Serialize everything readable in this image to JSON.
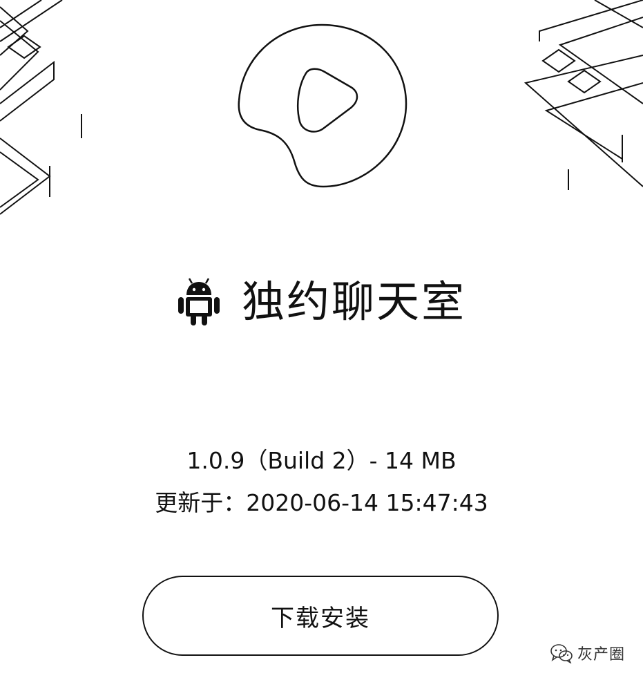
{
  "app": {
    "name": "独约聊天室",
    "platform_icon": "android-icon",
    "logo_icon": "play-blob-logo-icon"
  },
  "details": {
    "version_line": "1.0.9（Build 2）- 14 MB",
    "updated_line": "更新于：2020-06-14 15:47:43"
  },
  "actions": {
    "install_label": "下载安装"
  },
  "watermark": {
    "icon": "wechat-icon",
    "text": "灰产圈"
  },
  "colors": {
    "background": "#ffffff",
    "foreground": "#111111"
  }
}
